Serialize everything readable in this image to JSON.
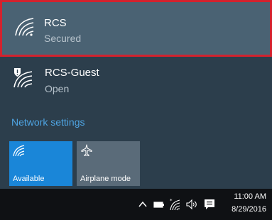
{
  "colors": {
    "flyout_background": "#2c3e4c",
    "selected_item_background": "#4a6273",
    "selection_border": "#d3222e",
    "link_accent": "#4ea4e2",
    "wifi_tile_active": "#1a86d8",
    "airplane_tile_inactive": "#5a6b79",
    "taskbar_background": "#0f1114"
  },
  "networks": [
    {
      "name": "RCS",
      "status": "Secured",
      "icon": "wifi-signal-icon",
      "selected": true
    },
    {
      "name": "RCS-Guest",
      "status": "Open",
      "icon": "wifi-shield-warning-icon",
      "selected": false
    }
  ],
  "network_settings_label": "Network settings",
  "quick_actions": {
    "wifi": {
      "label": "Available",
      "icon": "wifi-icon",
      "active": true
    },
    "airplane": {
      "label": "Airplane mode",
      "icon": "airplane-icon",
      "active": false
    }
  },
  "taskbar": {
    "tray_icons": [
      "chevron-up-icon",
      "battery-icon",
      "wifi-tray-icon",
      "volume-icon",
      "action-center-icon"
    ],
    "time": "11:00 AM",
    "date": "8/29/2016"
  }
}
